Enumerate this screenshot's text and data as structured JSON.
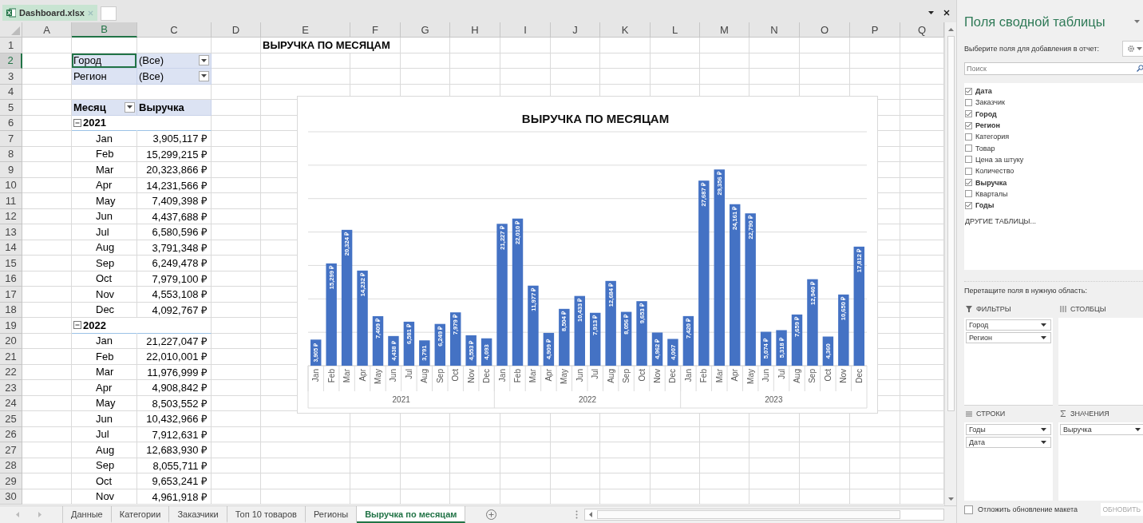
{
  "file_tab": {
    "name": "Dashboard.xlsx"
  },
  "sheet": {
    "columns": [
      {
        "label": "A",
        "selected": false
      },
      {
        "label": "B",
        "selected": true
      },
      {
        "label": "C",
        "selected": false
      },
      {
        "label": "D",
        "selected": false
      },
      {
        "label": "E",
        "selected": false
      },
      {
        "label": "F",
        "selected": false
      },
      {
        "label": "G",
        "selected": false
      },
      {
        "label": "H",
        "selected": false
      },
      {
        "label": "I",
        "selected": false
      },
      {
        "label": "J",
        "selected": false
      },
      {
        "label": "K",
        "selected": false
      },
      {
        "label": "L",
        "selected": false
      },
      {
        "label": "M",
        "selected": false
      },
      {
        "label": "N",
        "selected": false
      },
      {
        "label": "O",
        "selected": false
      },
      {
        "label": "P",
        "selected": false
      },
      {
        "label": "Q",
        "selected": false
      }
    ],
    "rows": [
      {
        "number": "1",
        "selected": false,
        "kind": "title",
        "text": "ВЫРУЧКА ПО МЕСЯЦАМ"
      },
      {
        "number": "2",
        "selected": true,
        "kind": "filter",
        "label": "Город",
        "value": "(Все)"
      },
      {
        "number": "3",
        "selected": false,
        "kind": "filter",
        "label": "Регион",
        "value": "(Все)"
      },
      {
        "number": "4",
        "selected": false,
        "kind": "empty"
      },
      {
        "number": "5",
        "selected": false,
        "kind": "header",
        "label": "Месяц",
        "value": "Выручка"
      },
      {
        "number": "6",
        "selected": false,
        "kind": "year",
        "label": "2021",
        "expanded": true
      },
      {
        "number": "7",
        "selected": false,
        "kind": "month",
        "label": "Jan",
        "value": "3,905,117 ₽"
      },
      {
        "number": "8",
        "selected": false,
        "kind": "month",
        "label": "Feb",
        "value": "15,299,215 ₽"
      },
      {
        "number": "9",
        "selected": false,
        "kind": "month",
        "label": "Mar",
        "value": "20,323,866 ₽"
      },
      {
        "number": "10",
        "selected": false,
        "kind": "month",
        "label": "Apr",
        "value": "14,231,566 ₽"
      },
      {
        "number": "11",
        "selected": false,
        "kind": "month",
        "label": "May",
        "value": "7,409,398 ₽"
      },
      {
        "number": "12",
        "selected": false,
        "kind": "month",
        "label": "Jun",
        "value": "4,437,688 ₽"
      },
      {
        "number": "13",
        "selected": false,
        "kind": "month",
        "label": "Jul",
        "value": "6,580,596 ₽"
      },
      {
        "number": "14",
        "selected": false,
        "kind": "month",
        "label": "Aug",
        "value": "3,791,348 ₽"
      },
      {
        "number": "15",
        "selected": false,
        "kind": "month",
        "label": "Sep",
        "value": "6,249,478 ₽"
      },
      {
        "number": "16",
        "selected": false,
        "kind": "month",
        "label": "Oct",
        "value": "7,979,100 ₽"
      },
      {
        "number": "17",
        "selected": false,
        "kind": "month",
        "label": "Nov",
        "value": "4,553,108 ₽"
      },
      {
        "number": "18",
        "selected": false,
        "kind": "month",
        "label": "Dec",
        "value": "4,092,767 ₽"
      },
      {
        "number": "19",
        "selected": false,
        "kind": "year",
        "label": "2022",
        "expanded": true
      },
      {
        "number": "20",
        "selected": false,
        "kind": "month",
        "label": "Jan",
        "value": "21,227,047 ₽"
      },
      {
        "number": "21",
        "selected": false,
        "kind": "month",
        "label": "Feb",
        "value": "22,010,001 ₽"
      },
      {
        "number": "22",
        "selected": false,
        "kind": "month",
        "label": "Mar",
        "value": "11,976,999 ₽"
      },
      {
        "number": "23",
        "selected": false,
        "kind": "month",
        "label": "Apr",
        "value": "4,908,842 ₽"
      },
      {
        "number": "24",
        "selected": false,
        "kind": "month",
        "label": "May",
        "value": "8,503,552 ₽"
      },
      {
        "number": "25",
        "selected": false,
        "kind": "month",
        "label": "Jun",
        "value": "10,432,966 ₽"
      },
      {
        "number": "26",
        "selected": false,
        "kind": "month",
        "label": "Jul",
        "value": "7,912,631 ₽"
      },
      {
        "number": "27",
        "selected": false,
        "kind": "month",
        "label": "Aug",
        "value": "12,683,930 ₽"
      },
      {
        "number": "28",
        "selected": false,
        "kind": "month",
        "label": "Sep",
        "value": "8,055,711 ₽"
      },
      {
        "number": "29",
        "selected": false,
        "kind": "month",
        "label": "Oct",
        "value": "9,653,241 ₽"
      },
      {
        "number": "30",
        "selected": false,
        "kind": "month",
        "label": "Nov",
        "value": "4,961,918 ₽"
      }
    ],
    "chart": {
      "chart_data": {
        "type": "bar",
        "title": "ВЫРУЧКА ПО МЕСЯЦАМ",
        "categories": [
          "Jan",
          "Feb",
          "Mar",
          "Apr",
          "May",
          "Jun",
          "Jul",
          "Aug",
          "Sep",
          "Oct",
          "Nov",
          "Dec",
          "Jan",
          "Feb",
          "Mar",
          "Apr",
          "May",
          "Jun",
          "Jul",
          "Aug",
          "Sep",
          "Oct",
          "Nov",
          "Dec",
          "Jan",
          "Feb",
          "Mar",
          "Apr",
          "May",
          "Jun",
          "Jul",
          "Aug",
          "Sep",
          "Oct",
          "Nov",
          "Dec"
        ],
        "values": [
          3905,
          15299,
          20324,
          14232,
          7409,
          4438,
          6581,
          3791,
          6249,
          7979,
          4553,
          4093,
          21227,
          22010,
          11977,
          4909,
          8504,
          10433,
          7913,
          12684,
          8056,
          9653,
          4962,
          4007,
          7420,
          27687,
          29356,
          24161,
          22790,
          5074,
          5318,
          7659,
          12940,
          4360,
          10650,
          17812
        ],
        "value_labels": [
          "3,905 ₽",
          "15,299 ₽",
          "20,324 ₽",
          "14,232 ₽",
          "7,409 ₽",
          "4,438 ₽",
          "6,581 ₽",
          "3,791",
          "6,249 ₽",
          "7,979 ₽",
          "4,553 ₽",
          "4,093",
          "21,227 ₽",
          "22,010 ₽",
          "11,977 ₽",
          "4,909 ₽",
          "8,504 ₽",
          "10,433 ₽",
          "7,913 ₽",
          "12,684 ₽",
          "8,056 ₽",
          "9,653 ₽",
          "4,962 ₽",
          "4,007",
          "7,420 ₽",
          "27,687 ₽",
          "29,356 ₽",
          "24,161 ₽",
          "22,790 ₽",
          "5,074 ₽",
          "5,318 ₽",
          "7,659 ₽",
          "12,940 ₽",
          "4,360",
          "10,650 ₽",
          "17,812 ₽"
        ],
        "ylim": [
          0,
          35000
        ]
      },
      "year_groups": [
        "2021",
        "2022",
        "2023"
      ]
    }
  },
  "sheet_tabs": [
    {
      "label": "Данные",
      "selected": false
    },
    {
      "label": "Категории",
      "selected": false
    },
    {
      "label": "Заказчики",
      "selected": false
    },
    {
      "label": "Топ 10 товаров",
      "selected": false
    },
    {
      "label": "Регионы",
      "selected": false
    },
    {
      "label": "Выручка по месяцам",
      "selected": true
    }
  ],
  "pivot_panel": {
    "title": "Поля сводной таблицы",
    "prompt": "Выберите поля для добавления в отчет:",
    "search": {
      "placeholder": "Поиск"
    },
    "fields": [
      {
        "name": "Дата",
        "checked": true
      },
      {
        "name": "Заказчик",
        "checked": false
      },
      {
        "name": "Город",
        "checked": true
      },
      {
        "name": "Регион",
        "checked": true
      },
      {
        "name": "Категория",
        "checked": false
      },
      {
        "name": "Товар",
        "checked": false
      },
      {
        "name": "Цена за штуку",
        "checked": false
      },
      {
        "name": "Количество",
        "checked": false
      },
      {
        "name": "Выручка",
        "checked": true
      },
      {
        "name": "Кварталы",
        "checked": false
      },
      {
        "name": "Годы",
        "checked": true
      }
    ],
    "more_tables": "ДРУГИЕ ТАБЛИЦЫ...",
    "drag_hint": "Перетащите поля в нужную область:",
    "areas": [
      {
        "kind": "filters",
        "title": "ФИЛЬТРЫ",
        "items": [
          "Город",
          "Регион"
        ]
      },
      {
        "kind": "columns",
        "title": "СТОЛБЦЫ"
      },
      {
        "kind": "rows",
        "title": "СТРОКИ",
        "items": [
          "Годы",
          "Дата"
        ]
      },
      {
        "kind": "values",
        "title": "ЗНАЧЕНИЯ",
        "items": [
          "Выручка"
        ]
      }
    ],
    "defer": {
      "label": "Отложить обновление макета",
      "checked": false
    },
    "update_button": {
      "label": "ОБНОВИТЬ",
      "disabled": true
    }
  }
}
